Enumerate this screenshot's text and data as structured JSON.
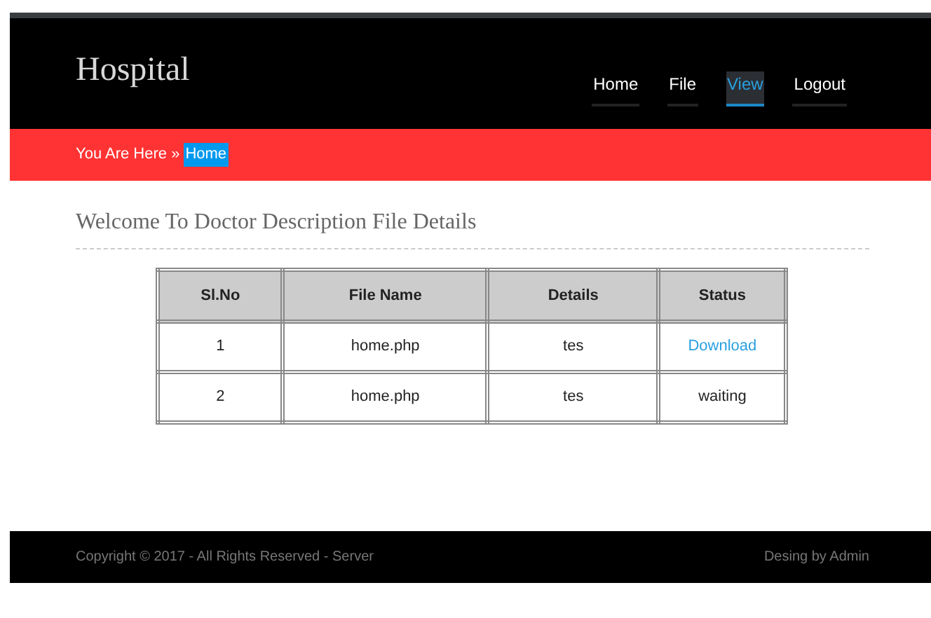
{
  "header": {
    "logo": "Hospital",
    "nav": [
      {
        "label": "Home",
        "selected": false
      },
      {
        "label": "File",
        "selected": false
      },
      {
        "label": "View",
        "selected": true
      },
      {
        "label": "Logout",
        "selected": false
      }
    ]
  },
  "breadcrumb": {
    "prefix": "You Are Here »",
    "current": "Home"
  },
  "heading": "Welcome To Doctor Description File Details",
  "table": {
    "columns": [
      "Sl.No",
      "File Name",
      "Details",
      "Status"
    ],
    "rows": [
      {
        "cells": [
          "1",
          "home.php",
          "tes"
        ],
        "status": {
          "kind": "link",
          "text": "Download"
        }
      },
      {
        "cells": [
          "2",
          "home.php",
          "tes"
        ],
        "status": {
          "kind": "text",
          "text": "waiting"
        }
      }
    ]
  },
  "footer": {
    "copyright": "Copyright © 2017 - All Rights Reserved - Server",
    "credit": "Desing by Admin"
  }
}
